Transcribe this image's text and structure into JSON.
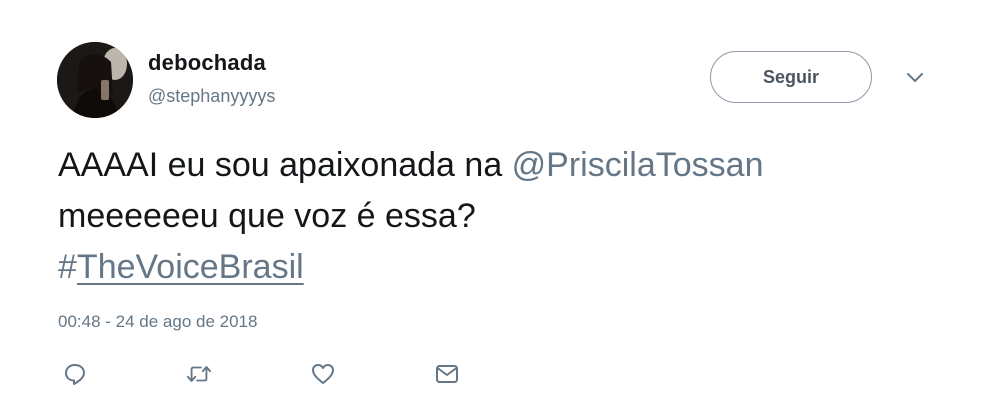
{
  "user": {
    "display_name": "debochada",
    "handle": "@stephanyyyys"
  },
  "follow_button": {
    "label": "Seguir"
  },
  "tweet": {
    "text_line1_prefix": "AAAAI eu sou apaixonada na ",
    "mention": "@PriscilaTossan",
    "text_line2": "meeeeeeu que voz é essa?",
    "hashtag_symbol": "#",
    "hashtag_word": "TheVoiceBrasil",
    "timestamp": "00:48 - 24 de ago de 2018"
  },
  "icons": {
    "more": "chevron-down-icon",
    "reply": "reply-icon",
    "retweet": "retweet-icon",
    "like": "heart-icon",
    "message": "envelope-icon"
  },
  "colors": {
    "text": "#14171a",
    "secondary": "#657786",
    "button_border": "#8d99a5"
  }
}
